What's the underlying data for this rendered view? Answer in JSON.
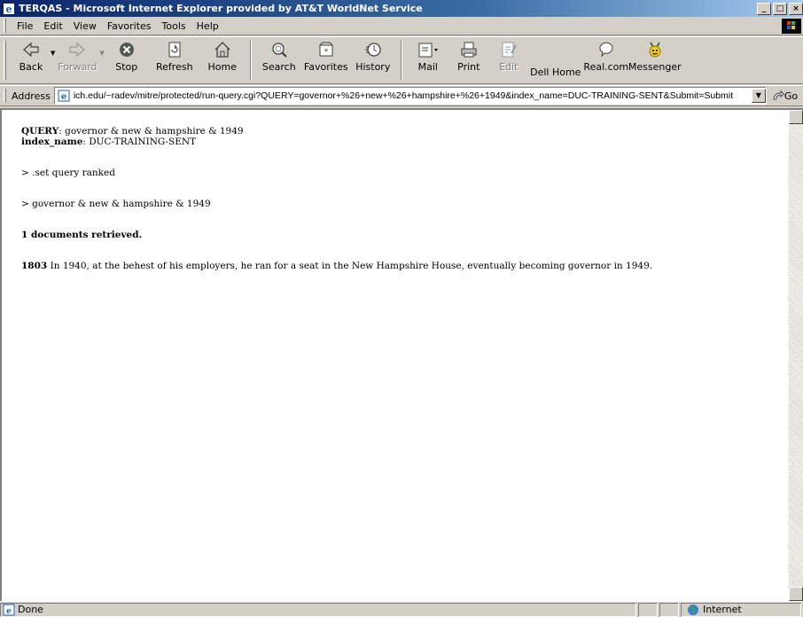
{
  "window": {
    "title": "TERQAS - Microsoft Internet Explorer provided by AT&T WorldNet Service",
    "controls": [
      "_",
      "□",
      "×"
    ]
  },
  "menu": {
    "items": [
      {
        "label": "File"
      },
      {
        "label": "Edit"
      },
      {
        "label": "View"
      },
      {
        "label": "Favorites"
      },
      {
        "label": "Tools"
      },
      {
        "label": "Help"
      }
    ]
  },
  "toolbar": {
    "back": "Back",
    "forward": "Forward",
    "stop": "Stop",
    "refresh": "Refresh",
    "home": "Home",
    "search": "Search",
    "favorites": "Favorites",
    "history": "History",
    "mail": "Mail",
    "print": "Print",
    "edit": "Edit",
    "dell_home": "Dell Home",
    "realcom": "Real.com",
    "messenger": "Messenger"
  },
  "address": {
    "label": "Address",
    "url": "ich.edu/~radev/mitre/protected/run-query.cgi?QUERY=governor+%26+new+%26+hampshire+%26+1949&index_name=DUC-TRAINING-SENT&Submit=Submit",
    "go_label": "Go"
  },
  "page": {
    "query_label": "QUERY",
    "query_value": ": governor & new & hampshire & 1949",
    "index_label": "index_name",
    "index_value": ": DUC-TRAINING-SENT",
    "cmd1": "> .set query ranked",
    "cmd2": "> governor & new & hampshire & 1949",
    "retrieved": "1 documents retrieved.",
    "result_id": "1803",
    "result_text": " In 1940, at the behest of his employers, he ran for a seat in the New Hampshire House, eventually becoming governor in 1949."
  },
  "status": {
    "text": "Done",
    "zone": "Internet"
  }
}
